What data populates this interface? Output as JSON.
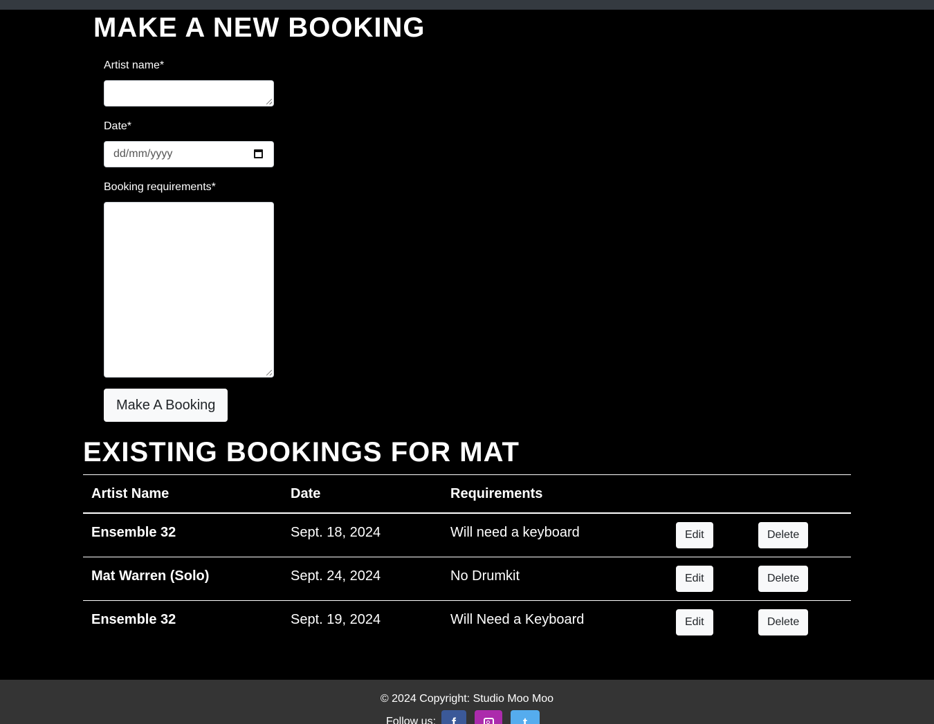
{
  "form": {
    "title": "MAKE A NEW BOOKING",
    "artist_label": "Artist name*",
    "artist_value": "",
    "date_label": "Date*",
    "date_placeholder": "dd/mm/yyyy",
    "requirements_label": "Booking requirements*",
    "requirements_value": "",
    "submit_label": "Make A Booking"
  },
  "bookings": {
    "title": "EXISTING BOOKINGS FOR MAT",
    "headers": [
      "Artist Name",
      "Date",
      "Requirements"
    ],
    "rows": [
      {
        "artist": "Ensemble 32",
        "date": "Sept. 18, 2024",
        "requirements": "Will need a keyboard",
        "edit_label": "Edit",
        "delete_label": "Delete"
      },
      {
        "artist": "Mat Warren (Solo)",
        "date": "Sept. 24, 2024",
        "requirements": "No Drumkit",
        "edit_label": "Edit",
        "delete_label": "Delete"
      },
      {
        "artist": "Ensemble 32",
        "date": "Sept. 19, 2024",
        "requirements": "Will Need a Keyboard",
        "edit_label": "Edit",
        "delete_label": "Delete"
      }
    ]
  },
  "footer": {
    "copyright": "© 2024 Copyright: Studio Moo Moo",
    "follow_label": "Follow us:",
    "social": [
      {
        "icon": "facebook-icon",
        "glyph": "f",
        "color": "#3b5998"
      },
      {
        "icon": "instagram-icon",
        "glyph": "",
        "color": "#ac2bac"
      },
      {
        "icon": "twitter-icon",
        "glyph": "t",
        "color": "#55acee"
      }
    ]
  }
}
